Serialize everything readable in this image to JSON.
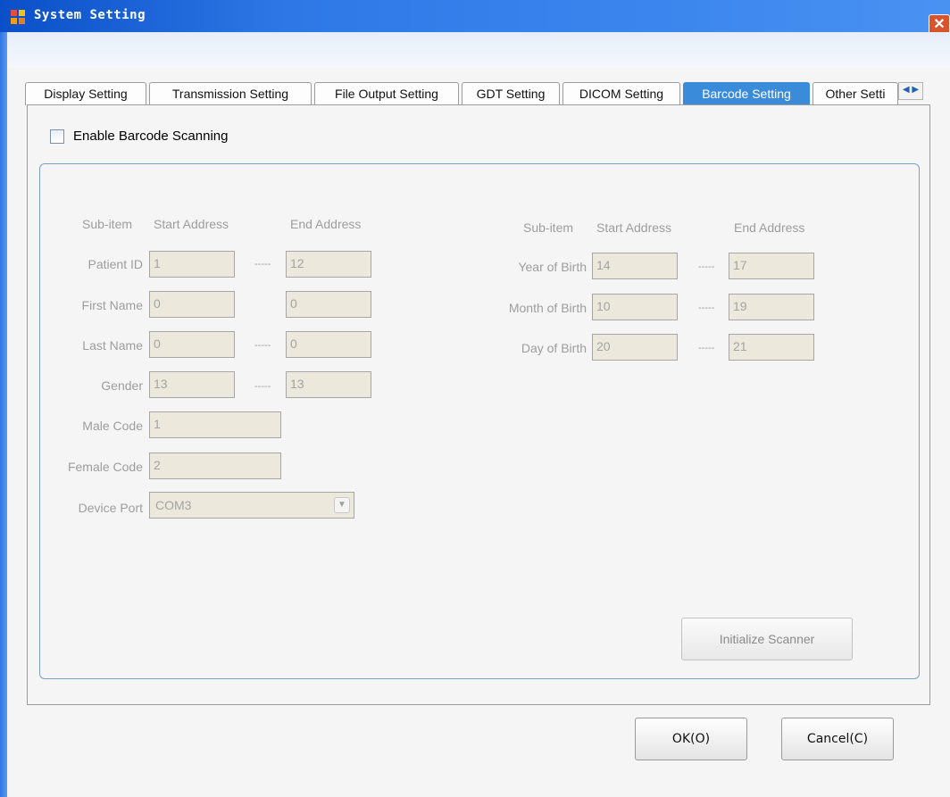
{
  "window": {
    "title": "System Setting",
    "close_glyph": "✕",
    "titlebar_color": "#2d78e6"
  },
  "tabs": [
    {
      "label": "Display Setting"
    },
    {
      "label": "Transmission Setting"
    },
    {
      "label": "File Output Setting"
    },
    {
      "label": "GDT Setting"
    },
    {
      "label": "DICOM Setting"
    },
    {
      "label": "Barcode Setting",
      "active": true
    },
    {
      "label": "Other Setti"
    }
  ],
  "tab_scroll": {
    "glyph": "◀ ▶"
  },
  "barcode": {
    "enable_label": "Enable Barcode Scanning",
    "enable_checked": false,
    "left": {
      "headers": {
        "subitem": "Sub-item",
        "start": "Start Address",
        "end": "End Address"
      },
      "rows": [
        {
          "label": "Patient ID",
          "start": "1",
          "end": "12",
          "dash": "-----"
        },
        {
          "label": "First Name",
          "start": "0",
          "end": "0",
          "dash": ""
        },
        {
          "label": "Last Name",
          "start": "0",
          "end": "0",
          "dash": "-----"
        },
        {
          "label": "Gender",
          "start": "13",
          "end": "13",
          "dash": "-----"
        }
      ],
      "male_code_label": "Male Code",
      "male_code": "1",
      "female_code_label": "Female Code",
      "female_code": "2",
      "device_port_label": "Device Port",
      "device_port": "COM3"
    },
    "right": {
      "headers": {
        "subitem": "Sub-item",
        "start": "Start Address",
        "end": "End Address"
      },
      "rows": [
        {
          "label": "Year of Birth",
          "start": "14",
          "end": "17",
          "dash": "-----"
        },
        {
          "label": "Month of Birth",
          "start": "10",
          "end": "19",
          "dash": "-----"
        },
        {
          "label": "Day of Birth",
          "start": "20",
          "end": "21",
          "dash": "-----"
        }
      ]
    },
    "init_button": "Initialize Scanner"
  },
  "footer": {
    "ok_label": "OK(O)",
    "cancel_label": "Cancel(C)"
  }
}
